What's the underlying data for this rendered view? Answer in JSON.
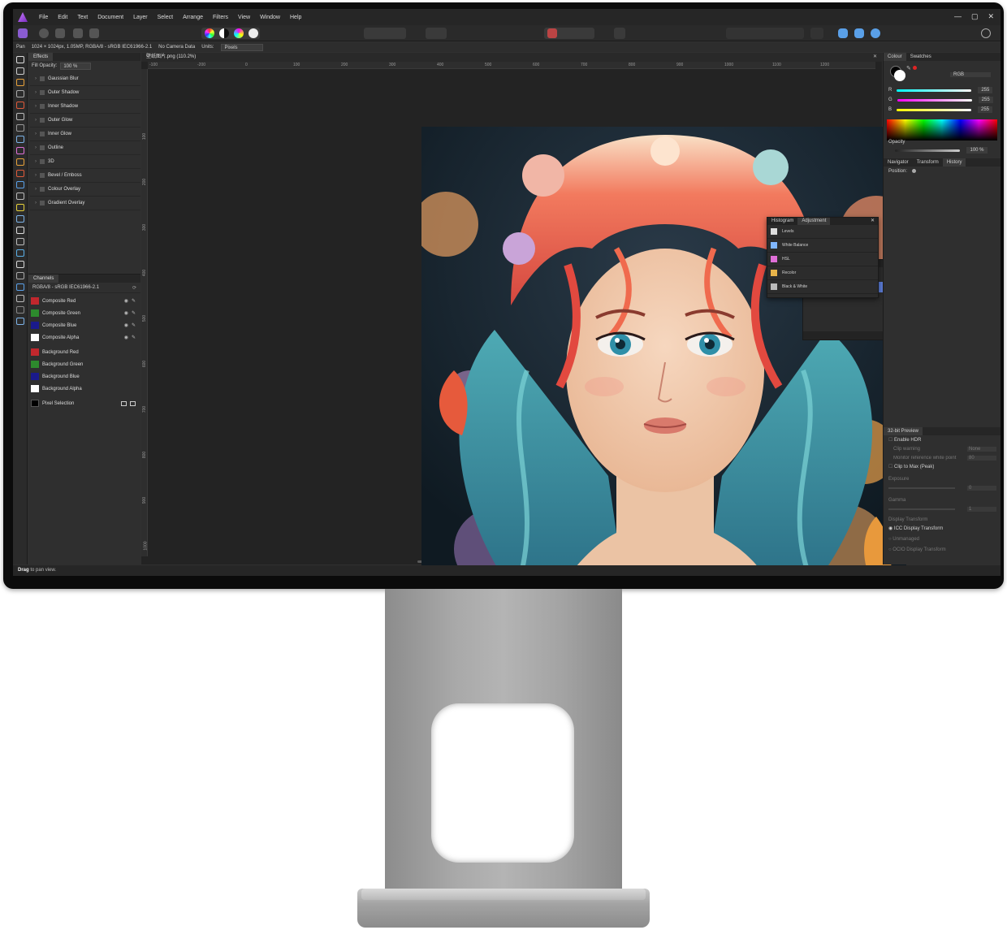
{
  "menu": [
    "File",
    "Edit",
    "Text",
    "Document",
    "Layer",
    "Select",
    "Arrange",
    "Filters",
    "View",
    "Window",
    "Help"
  ],
  "window_controls": {
    "minimize": "—",
    "maximize": "▢",
    "close": "✕"
  },
  "context": {
    "tool": "Pan",
    "info": "1024 × 1024px, 1.05MP, RGBA/8 - sRGB IEC61966-2.1",
    "camera": "No Camera Data",
    "units_label": "Units:",
    "units_value": "Pixels"
  },
  "effects_panel": {
    "tab": "Effects",
    "fill_label": "Fill Opacity:",
    "fill_value": "100 %",
    "items": [
      "Gaussian Blur",
      "Outer Shadow",
      "Inner Shadow",
      "Outer Glow",
      "Inner Glow",
      "Outline",
      "3D",
      "Bevel / Emboss",
      "Colour Overlay",
      "Gradient Overlay"
    ]
  },
  "channels_panel": {
    "tab": "Channels",
    "format": "RGBA/8 - sRGB IEC61966-2.1",
    "composite": [
      {
        "label": "Composite Red",
        "color": "#c0272d"
      },
      {
        "label": "Composite Green",
        "color": "#2d8a2d"
      },
      {
        "label": "Composite Blue",
        "color": "#1a1a8c"
      },
      {
        "label": "Composite Alpha",
        "color": "#ffffff"
      }
    ],
    "background": [
      {
        "label": "Background Red",
        "color": "#c0272d"
      },
      {
        "label": "Background Green",
        "color": "#2d8a2d"
      },
      {
        "label": "Background Blue",
        "color": "#1a1a8c"
      },
      {
        "label": "Background Alpha",
        "color": "#ffffff"
      }
    ],
    "pixel_selection": "Pixel Selection"
  },
  "document": {
    "tab_title": "壁纸图片.png (110.2%)",
    "ruler_h": [
      "-100",
      "-200",
      "0",
      "100",
      "200",
      "300",
      "400",
      "500",
      "600",
      "700",
      "800",
      "900",
      "1000",
      "1100",
      "1200"
    ],
    "ruler_v": [
      "100",
      "200",
      "300",
      "400",
      "500",
      "600",
      "700",
      "800",
      "900",
      "1000"
    ]
  },
  "adjustment_panel": {
    "tabs": [
      "Histogram",
      "Adjustment"
    ],
    "items": [
      {
        "label": "Levels",
        "color": "#ddd"
      },
      {
        "label": "White Balance",
        "color": "#7fb6ff"
      },
      {
        "label": "HSL",
        "color": "#e06fd8"
      },
      {
        "label": "Recolor",
        "color": "#e8b44a"
      },
      {
        "label": "Black & White",
        "color": "#bbbbbb"
      }
    ]
  },
  "colour_panel": {
    "tabs": [
      "Colour",
      "Swatches"
    ],
    "model": "RGB",
    "channels": [
      {
        "label": "R",
        "value": "255",
        "gradient": "#00ffff"
      },
      {
        "label": "G",
        "value": "255",
        "gradient": "#ff00ff"
      },
      {
        "label": "B",
        "value": "255",
        "gradient": "#ffff00"
      }
    ],
    "opacity_label": "Opacity",
    "opacity_value": "100 %"
  },
  "navigator_panel": {
    "tabs": [
      "Navigator",
      "Transform",
      "History"
    ],
    "position_label": "Position:"
  },
  "preview_panel": {
    "title": "32-bit Preview",
    "enable_hdr": "Enable HDR",
    "clip_warning": "Clip warning",
    "clip_warning_value": "None",
    "ref_white": "Monitor reference white point",
    "ref_white_value": "80",
    "clip_max": "Clip to Max (Peak)",
    "exposure": "Exposure",
    "exposure_value": "0",
    "gamma": "Gamma",
    "gamma_value": "1",
    "display_transform": "Display Transform",
    "icc": "ICC Display Transform",
    "unmanaged": "Unmanaged",
    "ocio": "OCIO Display Transform"
  },
  "status": {
    "bold": "Drag",
    "text": " to pan view."
  }
}
